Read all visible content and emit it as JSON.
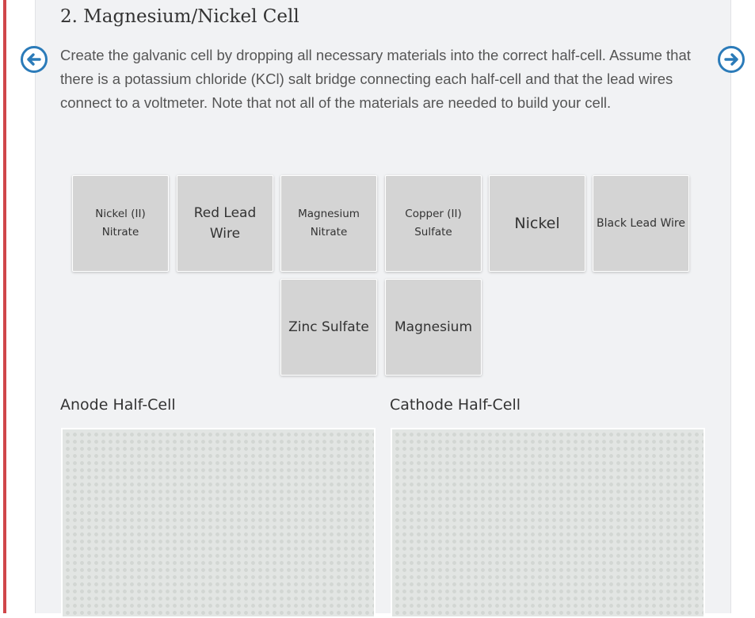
{
  "title": "2. Magnesium/Nickel Cell",
  "instructions": "Create the galvanic cell by dropping all necessary materials into the correct half-cell. Assume that there is a potassium chloride (KCl) salt bridge connecting each half-cell and that the lead wires connect to a voltmeter. Note that not all of the materials are needed to build your cell.",
  "nav": {
    "prev_icon": "arrow-left-circle-icon",
    "next_icon": "arrow-right-circle-icon"
  },
  "materials": [
    {
      "label": "Nickel (II) Nitrate"
    },
    {
      "label": "Red Lead Wire"
    },
    {
      "label": "Magnesium Nitrate"
    },
    {
      "label": "Copper (II) Sulfate"
    },
    {
      "label": "Nickel"
    },
    {
      "label": "Black Lead Wire"
    },
    {
      "label": "Zinc Sulfate"
    },
    {
      "label": "Magnesium"
    }
  ],
  "anode": {
    "label": "Anode Half-Cell"
  },
  "cathode": {
    "label": "Cathode Half-Cell"
  },
  "colors": {
    "accent": "#d0464a",
    "nav_icon": "#2b7bb9",
    "panel_bg": "#f1f2f4",
    "tile_bg": "#d4d4d4",
    "dropzone_bg": "#e2e5e3"
  }
}
